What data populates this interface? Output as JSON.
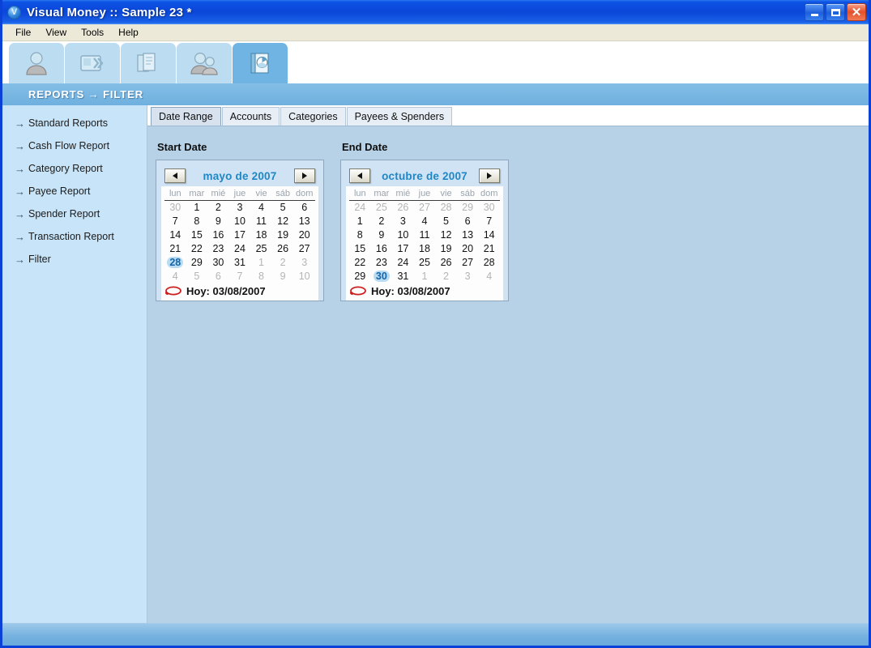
{
  "window": {
    "title": "Visual Money :: Sample 23 *",
    "app_icon": "shield-v-icon",
    "controls": {
      "minimize": "minimize-icon",
      "maximize": "maximize-icon",
      "close": "close-icon"
    }
  },
  "menubar": {
    "items": [
      "File",
      "View",
      "Tools",
      "Help"
    ]
  },
  "toolbar": {
    "tabs": [
      {
        "icon": "person-icon",
        "active": false
      },
      {
        "icon": "transfer-icon",
        "active": false
      },
      {
        "icon": "documents-icon",
        "active": false
      },
      {
        "icon": "people-icon",
        "active": false
      },
      {
        "icon": "reports-chart-icon",
        "active": true
      }
    ]
  },
  "banner": {
    "text": "REPORTS → FILTER"
  },
  "sidebar": {
    "items": [
      {
        "label": "Standard Reports"
      },
      {
        "label": "Cash Flow Report"
      },
      {
        "label": "Category Report"
      },
      {
        "label": "Payee Report"
      },
      {
        "label": "Spender Report"
      },
      {
        "label": "Transaction Report"
      },
      {
        "label": "Filter"
      }
    ]
  },
  "tabs": [
    {
      "label": "Date Range",
      "active": true
    },
    {
      "label": "Accounts",
      "active": false
    },
    {
      "label": "Categories",
      "active": false
    },
    {
      "label": "Payees & Spenders",
      "active": false
    }
  ],
  "start_date": {
    "title": "Start Date",
    "month_label": "mayo de 2007",
    "prev_label": "◀",
    "next_label": "▶",
    "weekdays": [
      "lun",
      "mar",
      "mié",
      "jue",
      "vie",
      "sáb",
      "dom"
    ],
    "weeks": [
      [
        {
          "d": "30",
          "o": true
        },
        {
          "d": "1"
        },
        {
          "d": "2"
        },
        {
          "d": "3"
        },
        {
          "d": "4"
        },
        {
          "d": "5"
        },
        {
          "d": "6"
        }
      ],
      [
        {
          "d": "7"
        },
        {
          "d": "8"
        },
        {
          "d": "9"
        },
        {
          "d": "10"
        },
        {
          "d": "11"
        },
        {
          "d": "12"
        },
        {
          "d": "13"
        }
      ],
      [
        {
          "d": "14"
        },
        {
          "d": "15"
        },
        {
          "d": "16"
        },
        {
          "d": "17"
        },
        {
          "d": "18"
        },
        {
          "d": "19"
        },
        {
          "d": "20"
        }
      ],
      [
        {
          "d": "21"
        },
        {
          "d": "22"
        },
        {
          "d": "23"
        },
        {
          "d": "24"
        },
        {
          "d": "25"
        },
        {
          "d": "26"
        },
        {
          "d": "27"
        }
      ],
      [
        {
          "d": "28",
          "sel": true
        },
        {
          "d": "29"
        },
        {
          "d": "30"
        },
        {
          "d": "31"
        },
        {
          "d": "1",
          "o": true
        },
        {
          "d": "2",
          "o": true
        },
        {
          "d": "3",
          "o": true
        }
      ],
      [
        {
          "d": "4",
          "o": true
        },
        {
          "d": "5",
          "o": true
        },
        {
          "d": "6",
          "o": true
        },
        {
          "d": "7",
          "o": true
        },
        {
          "d": "8",
          "o": true
        },
        {
          "d": "9",
          "o": true
        },
        {
          "d": "10",
          "o": true
        }
      ]
    ],
    "selected_day": "28",
    "today_text": "Hoy: 03/08/2007"
  },
  "end_date": {
    "title": "End Date",
    "month_label": "octubre de 2007",
    "prev_label": "◀",
    "next_label": "▶",
    "weekdays": [
      "lun",
      "mar",
      "mié",
      "jue",
      "vie",
      "sáb",
      "dom"
    ],
    "weeks": [
      [
        {
          "d": "24",
          "o": true
        },
        {
          "d": "25",
          "o": true
        },
        {
          "d": "26",
          "o": true
        },
        {
          "d": "27",
          "o": true
        },
        {
          "d": "28",
          "o": true
        },
        {
          "d": "29",
          "o": true
        },
        {
          "d": "30",
          "o": true
        }
      ],
      [
        {
          "d": "1"
        },
        {
          "d": "2"
        },
        {
          "d": "3"
        },
        {
          "d": "4"
        },
        {
          "d": "5"
        },
        {
          "d": "6"
        },
        {
          "d": "7"
        }
      ],
      [
        {
          "d": "8"
        },
        {
          "d": "9"
        },
        {
          "d": "10"
        },
        {
          "d": "11"
        },
        {
          "d": "12"
        },
        {
          "d": "13"
        },
        {
          "d": "14"
        }
      ],
      [
        {
          "d": "15"
        },
        {
          "d": "16"
        },
        {
          "d": "17"
        },
        {
          "d": "18"
        },
        {
          "d": "19"
        },
        {
          "d": "20"
        },
        {
          "d": "21"
        }
      ],
      [
        {
          "d": "22"
        },
        {
          "d": "23"
        },
        {
          "d": "24"
        },
        {
          "d": "25"
        },
        {
          "d": "26"
        },
        {
          "d": "27"
        },
        {
          "d": "28"
        }
      ],
      [
        {
          "d": "29"
        },
        {
          "d": "30",
          "sel": true
        },
        {
          "d": "31"
        },
        {
          "d": "1",
          "o": true
        },
        {
          "d": "2",
          "o": true
        },
        {
          "d": "3",
          "o": true
        },
        {
          "d": "4",
          "o": true
        }
      ]
    ],
    "selected_day": "30",
    "today_text": "Hoy: 03/08/2007"
  },
  "colors": {
    "accent_blue": "#1f87c4",
    "banner_bg": "#6fb0df",
    "sidebar_bg": "#c8e4f8",
    "content_bg": "#b7d1e7",
    "selected_tab": "#6fb4e2",
    "today_marker": "#cc1f1f"
  }
}
